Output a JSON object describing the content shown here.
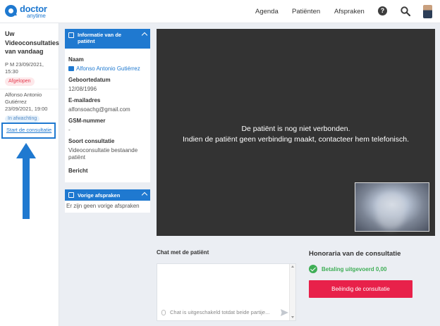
{
  "header": {
    "logo_line1": "doctor",
    "logo_line2": "anytime",
    "nav": [
      "Agenda",
      "Patiënten",
      "Afspraken"
    ],
    "help_glyph": "?"
  },
  "sidebar": {
    "title": "Uw Videoconsultaties van vandaag",
    "consult1": {
      "time": "P M 23/09/2021, 15:30",
      "status": "Afgelopen"
    },
    "consult2": {
      "name": "Alfonso Antonio Gutiérrez",
      "time": "23/09/2021, 19:00",
      "status": "In afwachting",
      "link": "Start de consultatie"
    }
  },
  "patient_card": {
    "header": "Informatie van de patiënt",
    "fields": [
      {
        "label": "Naam",
        "value": "Alfonso Antonio Gutiérrez"
      },
      {
        "label": "Geboortedatum",
        "value": "12/08/1996"
      },
      {
        "label": "E-mailadres",
        "value": "alfonsoachg@gmail.com"
      },
      {
        "label": "GSM-nummer",
        "value": "-"
      },
      {
        "label": "Soort consultatie",
        "value": "Videoconsultatie bestaande patiënt"
      },
      {
        "label": "Bericht",
        "value": ""
      }
    ]
  },
  "previous_card": {
    "header": "Vorige afspraken",
    "empty_text": "Er zijn geen vorige afspraken"
  },
  "video": {
    "line1": "De patiënt is nog niet verbonden.",
    "line2": "Indien de patiënt geen verbinding maakt, contacteer hem telefonisch."
  },
  "chat": {
    "title": "Chat met de patiënt",
    "placeholder": "Chat is uitgeschakeld totdat beide partije..."
  },
  "honoraria": {
    "title": "Honoraria van de consultatie",
    "status": "Betaling uitgevoerd 0,00",
    "end_button": "Beëindig de consultatie"
  },
  "colors": {
    "brand": "#1f79d0",
    "danger": "#e8214a",
    "success": "#3fae56",
    "video_bg": "#333333"
  },
  "icons": [
    "search-icon",
    "help-icon",
    "chevron-up-icon",
    "folder-icon",
    "calendar-icon",
    "check-circle-icon",
    "send-icon",
    "clip-icon",
    "arrow-up-icon"
  ]
}
